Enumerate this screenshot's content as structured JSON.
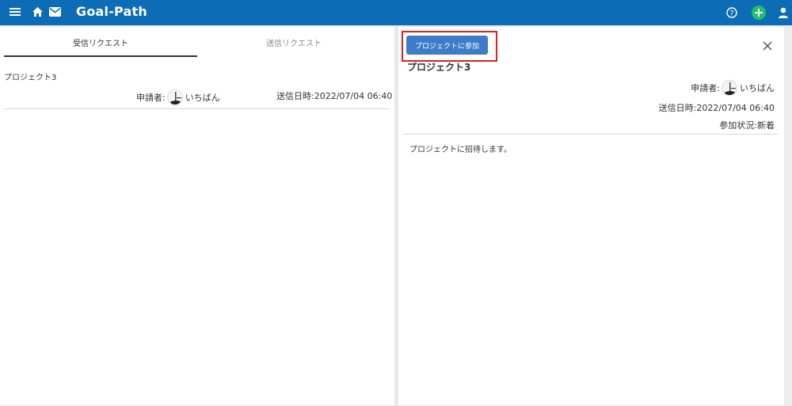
{
  "app": {
    "title": "Goal-Path",
    "icons": {
      "menu": "menu-icon",
      "home": "home-icon",
      "mail": "mail-icon",
      "help": "help-icon",
      "add": "add-icon",
      "user": "user-icon"
    },
    "colors": {
      "appbar": "#0d6cb6",
      "accent_green": "#1fc06b",
      "button": "#3d7cc8",
      "highlight": "#e01f1f"
    }
  },
  "tabs": [
    {
      "label": "受信リクエスト",
      "active": true
    },
    {
      "label": "送信リクエスト",
      "active": false
    }
  ],
  "request_list": [
    {
      "project": "プロジェクト3",
      "applicant_label": "申請者:",
      "applicant_name": "いちばん",
      "sent_label": "送信日時:",
      "sent_value": "2022/07/04 06:40"
    }
  ],
  "detail": {
    "join_button": "プロジェクトに参加",
    "project": "プロジェクト3",
    "applicant_label": "申請者:",
    "applicant_name": "いちばん",
    "sent_label": "送信日時:",
    "sent_value": "2022/07/04 06:40",
    "status_label": "参加状況:",
    "status_value": "新着",
    "message": "プロジェクトに招待します。"
  }
}
